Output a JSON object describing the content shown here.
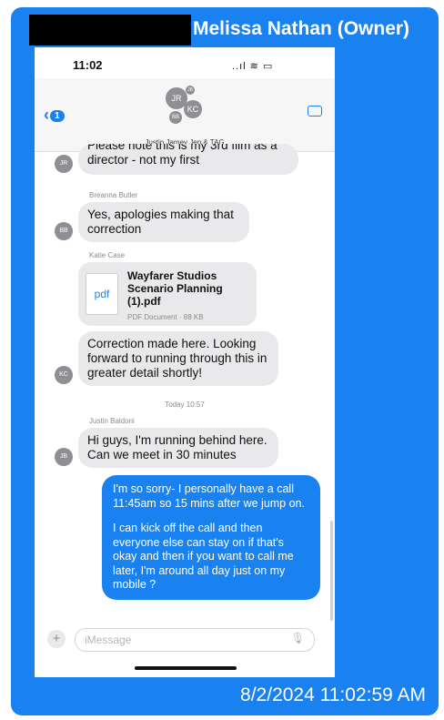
{
  "caption": {
    "owner": "Melissa Nathan (Owner)",
    "timestamp": "8/2/2024 11:02:59 AM"
  },
  "status": {
    "time": "11:02",
    "indicators": "..ıl ≋ ▭"
  },
  "header": {
    "back_badge": "1",
    "group_name": "Justin Jamey Jen & TAG",
    "avatar_initials": [
      "JR",
      "KC",
      "BB",
      "JB"
    ]
  },
  "messages": {
    "m1_text": "director - not my first",
    "m1_partial": "Please note this is my 3rd film as a",
    "m1_avatar": "JR",
    "m2_sender": "Breanna Butler",
    "m2_text": "Yes, apologies making that correction",
    "m2_avatar": "BB",
    "m3_sender": "Katie Case",
    "file_title": "Wayfarer Studios Scenario Planning (1).pdf",
    "file_meta": "PDF Document · 88 KB",
    "file_icon_label": "pdf",
    "m3_text": "Correction made here. Looking forward to running through this in greater detail shortly!",
    "m3_avatar": "KC",
    "day_stamp": "Today 10:57",
    "m4_sender": "Justin Baldoni",
    "m4_text": "Hi guys, I'm running behind here. Can we meet in 30 minutes",
    "m4_avatar": "JB",
    "me_text_1": "I'm so sorry- I personally have a call 11:45am so 15 mins after we jump on.",
    "me_text_2": "I can kick off the call and then everyone else can stay on if that's okay and then if you want to call me later, I'm around all day just on my mobile ?"
  },
  "input": {
    "placeholder": "iMessage"
  },
  "colors": {
    "accent": "#1a82f0",
    "incoming_bubble": "#e9e9eb"
  }
}
